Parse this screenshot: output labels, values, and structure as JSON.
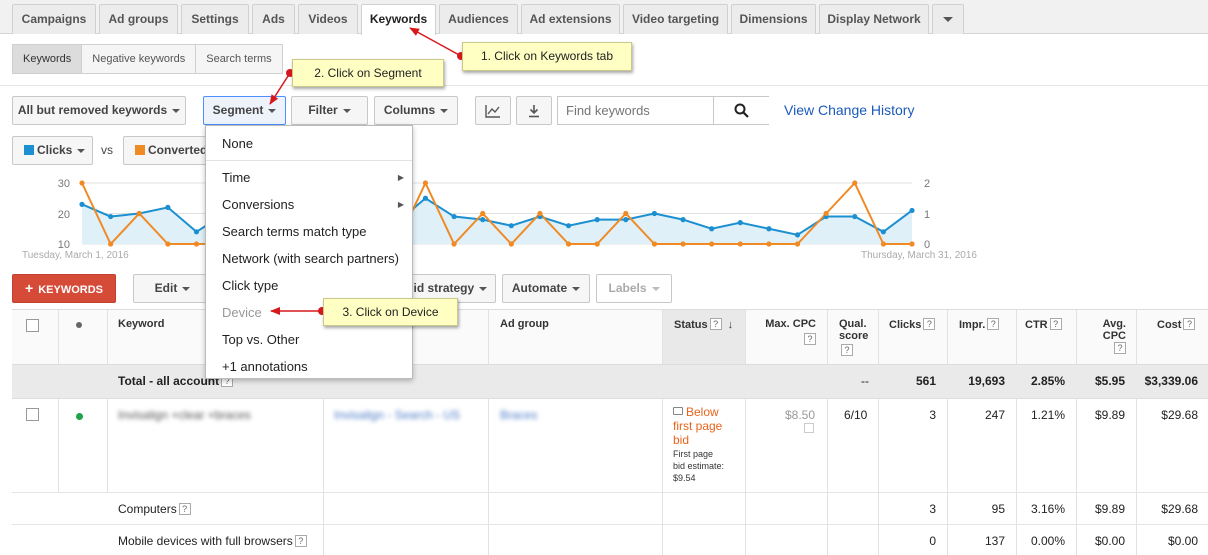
{
  "top_tabs": [
    "Campaigns",
    "Ad groups",
    "Settings",
    "Ads",
    "Videos",
    "Keywords",
    "Audiences",
    "Ad extensions",
    "Video targeting",
    "Dimensions",
    "Display Network"
  ],
  "active_tab": "Keywords",
  "sub_tabs": [
    "Keywords",
    "Negative keywords",
    "Search terms"
  ],
  "toolbar": {
    "filter_view": "All but removed keywords",
    "segment": "Segment",
    "filter": "Filter",
    "columns": "Columns",
    "search_placeholder": "Find keywords",
    "history_link": "View Change History"
  },
  "chart": {
    "metric1": "Clicks",
    "vs": "vs",
    "metric2": "Converted",
    "y_left_ticks": [
      "30",
      "20",
      "10"
    ],
    "y_right_ticks": [
      "2",
      "1",
      "0"
    ],
    "start_date": "Tuesday, March 1, 2016",
    "end_date": "Thursday, March 31, 2016"
  },
  "chart_data": {
    "type": "line",
    "xlabel": "",
    "ylabel": "",
    "ylim": [
      10,
      30
    ],
    "y2lim": [
      0,
      2
    ],
    "series": [
      {
        "name": "Clicks",
        "color": "#1c8fd0",
        "axis": "left",
        "values": [
          23,
          19,
          20,
          22,
          14,
          20,
          17,
          20,
          18,
          16,
          18,
          17,
          25,
          19,
          18,
          16,
          19,
          16,
          18,
          18,
          20,
          18,
          15,
          17,
          15,
          13,
          19,
          19,
          14,
          21
        ]
      },
      {
        "name": "Converted",
        "color": "#f08a24",
        "axis": "right",
        "values": [
          2,
          0,
          1,
          0,
          0,
          0,
          0,
          0,
          0,
          0,
          0,
          0,
          2,
          0,
          1,
          0,
          1,
          0,
          0,
          1,
          0,
          0,
          0,
          0,
          0,
          0,
          1,
          2,
          0,
          0
        ]
      }
    ]
  },
  "actions": {
    "add_keywords": "KEYWORDS",
    "edit": "Edit",
    "bid_strategy": "Bid strategy",
    "automate": "Automate",
    "labels": "Labels"
  },
  "segment_menu": [
    "None",
    "Time",
    "Conversions",
    "Search terms match type",
    "Network (with search partners)",
    "Click type",
    "Device",
    "Top vs. Other",
    "+1 annotations"
  ],
  "table": {
    "headers": {
      "keyword": "Keyword",
      "ad_group": "Ad group",
      "status": "Status",
      "max_cpc": "Max. CPC",
      "qual_score_1": "Qual.",
      "qual_score_2": "score",
      "clicks": "Clicks",
      "impr": "Impr.",
      "ctr": "CTR",
      "avg_cpc_1": "Avg.",
      "avg_cpc_2": "CPC",
      "cost": "Cost"
    },
    "total": {
      "label": "Total - all account",
      "qual": "--",
      "clicks": "561",
      "impr": "19,693",
      "ctr": "2.85%",
      "avg_cpc": "$5.95",
      "cost": "$3,339.06"
    },
    "row1": {
      "keyword": "Invisalign +clear +braces",
      "campaign": "Invisalign - Search - US",
      "ad_group": "Braces",
      "status": "Below first page bid",
      "status_line1": "Below",
      "status_line2": "first page",
      "status_line3": "bid",
      "estimate": "First page bid estimate: $9.54",
      "estimate_line1": "First page",
      "estimate_line2": "bid estimate:",
      "estimate_line3": "$9.54",
      "max_cpc": "$8.50",
      "qual": "6/10",
      "clicks": "3",
      "impr": "247",
      "ctr": "1.21%",
      "avg_cpc": "$9.89",
      "cost": "$29.68"
    },
    "segments": [
      {
        "label": "Computers",
        "clicks": "3",
        "impr": "95",
        "ctr": "3.16%",
        "avg_cpc": "$9.89",
        "cost": "$29.68"
      },
      {
        "label": "Mobile devices with full browsers",
        "clicks": "0",
        "impr": "137",
        "ctr": "0.00%",
        "avg_cpc": "$0.00",
        "cost": "$0.00"
      }
    ]
  },
  "callouts": {
    "step1": "1. Click on Keywords tab",
    "step2": "2. Click on Segment",
    "step3": "3. Click on Device"
  },
  "colors": {
    "clicks": "#1c8fd0",
    "converted": "#f08a24",
    "accent_red": "#d64a38",
    "callout": "#ffffc4",
    "status_warn": "#e8641b"
  }
}
